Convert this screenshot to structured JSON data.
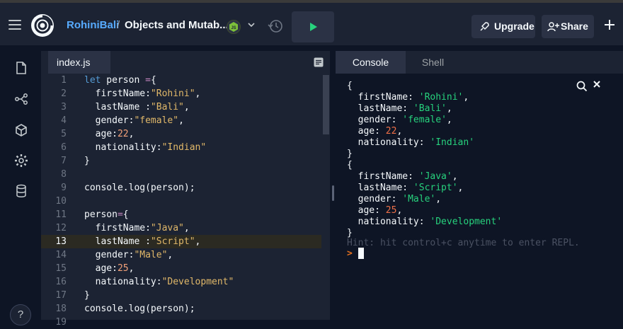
{
  "header": {
    "owner": "RohiniBali",
    "separator": "/",
    "repl_name": "Objects and Mutab...",
    "upgrade_label": "Upgrade",
    "share_label": "Share"
  },
  "sidebar": {
    "icons": [
      "files-icon",
      "version-control-icon",
      "packages-icon",
      "settings-icon",
      "database-icon"
    ],
    "help_label": "?"
  },
  "editor": {
    "tab_label": "index.js",
    "active_line": 13,
    "lines": [
      {
        "n": "1",
        "text": "let person ={"
      },
      {
        "n": "2",
        "text": "  firstName:\"Rohini\","
      },
      {
        "n": "3",
        "text": "  lastName :\"Bali\","
      },
      {
        "n": "4",
        "text": "  gender:\"female\","
      },
      {
        "n": "5",
        "text": "  age:22,"
      },
      {
        "n": "6",
        "text": "  nationality:\"Indian\""
      },
      {
        "n": "7",
        "text": "}"
      },
      {
        "n": "8",
        "text": ""
      },
      {
        "n": "9",
        "text": "console.log(person);"
      },
      {
        "n": "10",
        "text": ""
      },
      {
        "n": "11",
        "text": "person={"
      },
      {
        "n": "12",
        "text": "  firstName:\"Java\","
      },
      {
        "n": "13",
        "text": "  lastName :\"Script\","
      },
      {
        "n": "14",
        "text": "  gender:\"Male\","
      },
      {
        "n": "15",
        "text": "  age:25,"
      },
      {
        "n": "16",
        "text": "  nationality:\"Development\""
      },
      {
        "n": "17",
        "text": "}"
      },
      {
        "n": "18",
        "text": "console.log(person);"
      },
      {
        "n": "19",
        "text": ""
      }
    ]
  },
  "console": {
    "tabs": [
      "Console",
      "Shell"
    ],
    "output": [
      "{",
      "  firstName: 'Rohini',",
      "  lastName: 'Bali',",
      "  gender: 'female',",
      "  age: 22,",
      "  nationality: 'Indian'",
      "}",
      "{",
      "  firstName: 'Java',",
      "  lastName: 'Script',",
      "  gender: 'Male',",
      "  age: 25,",
      "  nationality: 'Development'",
      "}"
    ],
    "hint": "Hint: hit control+c anytime to enter REPL.",
    "prompt": ">"
  },
  "colors": {
    "keyword": "#569cd6",
    "string": "#e1b869",
    "number": "#f5a27a",
    "operator": "#c586c0",
    "console_string": "#27d27d",
    "console_number": "#f07048",
    "accent": "#57abff"
  }
}
